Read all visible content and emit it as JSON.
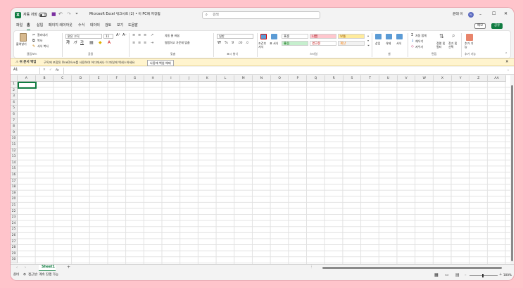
{
  "titlebar": {
    "autosave_label": "자동 저장",
    "autosave_state": "끔",
    "doc_title": "Microsoft Excel 워크시트 (2) • 이 PC에 저장됨",
    "search_placeholder": "검색",
    "user_name": "윤태 이",
    "user_initials": "YL"
  },
  "menu": {
    "items": [
      "파일",
      "홈",
      "삽입",
      "페이지 레이아웃",
      "수식",
      "데이터",
      "검토",
      "보기",
      "도움말"
    ],
    "memo": "메모",
    "share": "공유"
  },
  "ribbon": {
    "clipboard": {
      "paste": "붙여넣기",
      "cut": "잘라내기",
      "copy": "복사",
      "format_painter": "서식 복사",
      "label": "클립보드"
    },
    "font": {
      "name": "맑은 고딕",
      "size": "11",
      "label": "글꼴"
    },
    "alignment": {
      "wrap": "자동 줄 바꿈",
      "merge": "병합하고 가운데 맞춤",
      "label": "맞춤"
    },
    "number": {
      "format": "일반",
      "label": "표시 형식"
    },
    "styles": {
      "conditional": "조건부 서식",
      "table": "표 서식",
      "cells": [
        {
          "name": "표준",
          "bg": "#ffffff",
          "fg": "#222222"
        },
        {
          "name": "나쁨",
          "bg": "#ffc7ce",
          "fg": "#9c0006"
        },
        {
          "name": "보통",
          "bg": "#ffeb9c",
          "fg": "#9c5700"
        },
        {
          "name": "좋음",
          "bg": "#c6efce",
          "fg": "#006100"
        },
        {
          "name": "경고문",
          "bg": "#ffffff",
          "fg": "#c00000"
        },
        {
          "name": "계산",
          "bg": "#f2f2f2",
          "fg": "#fa7d00"
        }
      ],
      "label": "스타일"
    },
    "cells": {
      "insert": "삽입",
      "delete": "삭제",
      "format": "서식",
      "label": "셀"
    },
    "editing": {
      "autosum": "자동 합계",
      "fill": "채우기",
      "clear": "지우기",
      "sort": "정렬 및 필터",
      "find": "찾기 및 선택",
      "label": "편집"
    },
    "addins": {
      "btn": "추가 기능",
      "label": "추가 기능"
    }
  },
  "msgbar": {
    "title": "⚠ 쉬 문서 백업",
    "text": "구독에 포함된 OneDrive를 사용하여 어디에서나 이 파일에 액세스하세요.",
    "button": "나중에 백업 해제"
  },
  "formula": {
    "namebox": "A1",
    "fx": "fx",
    "content": ""
  },
  "columns": [
    "A",
    "B",
    "C",
    "D",
    "E",
    "F",
    "G",
    "H",
    "I",
    "J",
    "K",
    "L",
    "M",
    "N",
    "O",
    "P",
    "Q",
    "R",
    "S",
    "T",
    "U",
    "V",
    "W",
    "X",
    "Y",
    "Z",
    "AA"
  ],
  "rows": [
    "1",
    "2",
    "3",
    "4",
    "5",
    "6",
    "7",
    "8",
    "9",
    "10",
    "11",
    "12",
    "13",
    "14",
    "15",
    "16",
    "17",
    "18",
    "19",
    "20",
    "21",
    "22",
    "23",
    "24",
    "25",
    "26",
    "27",
    "28",
    "29",
    "30"
  ],
  "sheets": {
    "tabs": [
      "Sheet1"
    ],
    "add": "+"
  },
  "status": {
    "ready": "준비",
    "accessibility": "접근성: 계속 진행 가능",
    "zoom": "100%"
  }
}
